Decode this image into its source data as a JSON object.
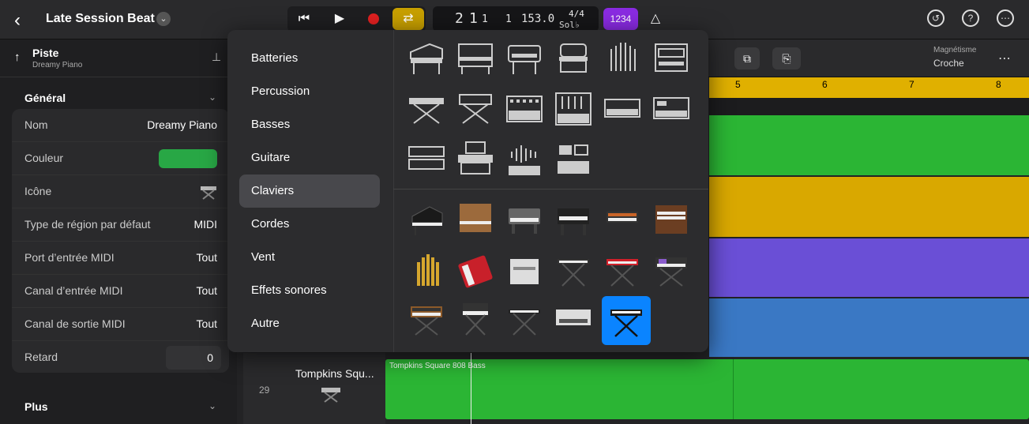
{
  "header": {
    "back_label": "‹",
    "project_title": "Late Session Beat",
    "lcd": {
      "bar": "2",
      "beat": "1",
      "div": "1",
      "tick": "1",
      "tempo": "153.0",
      "signature": "4/4",
      "key": "Sol♭ min"
    },
    "count_in": "1234"
  },
  "inspector": {
    "track_heading": "Piste",
    "track_name": "Dreamy Piano",
    "general_title": "Général",
    "rows": [
      {
        "label": "Nom",
        "value": "Dreamy Piano"
      },
      {
        "label": "Couleur",
        "value": ""
      },
      {
        "label": "Icône",
        "value": ""
      },
      {
        "label": "Type de région par défaut",
        "value": "MIDI"
      },
      {
        "label": "Port d’entrée MIDI",
        "value": "Tout"
      },
      {
        "label": "Canal d’entrée MIDI",
        "value": "Tout"
      },
      {
        "label": "Canal de sortie MIDI",
        "value": "Tout"
      },
      {
        "label": "Retard",
        "value": "0"
      }
    ],
    "more_title": "Plus",
    "color_value": "#28a745"
  },
  "toolbar2": {
    "snap_label": "Magnétisme",
    "snap_value": "Croche"
  },
  "ruler": {
    "bars": [
      "5",
      "6",
      "7",
      "8"
    ]
  },
  "track29": {
    "number": "29",
    "name": "Tompkins Squ...",
    "region_name": "Tompkins Square 808 Bass"
  },
  "icon_menu": {
    "categories": [
      "Batteries",
      "Percussion",
      "Basses",
      "Guitare",
      "Claviers",
      "Cordes",
      "Vent",
      "Effets sonores",
      "Autre"
    ],
    "selected_category": "Claviers"
  },
  "colors": {
    "ruler": "#e0b000",
    "green": "#2bb534",
    "yellow": "#d9a800",
    "purple": "#6a4fd6",
    "blue": "#3a78c4",
    "accent": "#0a84ff"
  }
}
